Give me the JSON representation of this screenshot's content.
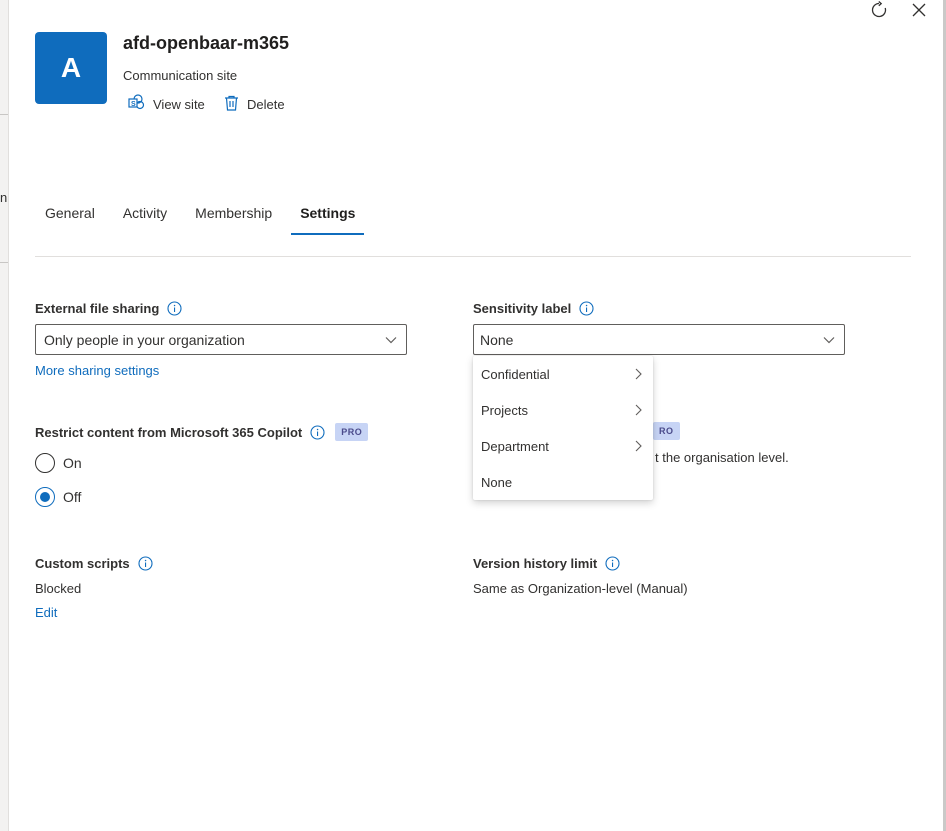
{
  "site": {
    "avatar_letter": "A",
    "title": "afd-openbaar-m365",
    "type": "Communication site"
  },
  "commands": {
    "view_site": "View site",
    "delete": "Delete"
  },
  "tabs": [
    {
      "label": "General"
    },
    {
      "label": "Activity"
    },
    {
      "label": "Membership"
    },
    {
      "label": "Settings",
      "active": true
    }
  ],
  "external_sharing": {
    "label": "External file sharing",
    "value": "Only people in your organization",
    "link": "More sharing settings"
  },
  "sensitivity": {
    "label": "Sensitivity label",
    "value": "None",
    "menu": [
      {
        "label": "Confidential",
        "has_submenu": true
      },
      {
        "label": "Projects",
        "has_submenu": true
      },
      {
        "label": "Department",
        "has_submenu": true
      },
      {
        "label": "None",
        "has_submenu": false
      }
    ]
  },
  "copilot": {
    "label": "Restrict content from Microsoft 365 Copilot",
    "badge": "PRO",
    "options": [
      {
        "label": "On",
        "checked": false
      },
      {
        "label": "Off",
        "checked": true
      }
    ]
  },
  "obscured": {
    "badge": "RO",
    "text": "t the organisation level."
  },
  "custom_scripts": {
    "label": "Custom scripts",
    "value": "Blocked",
    "link": "Edit"
  },
  "version_history": {
    "label": "Version history limit",
    "value": "Same as Organization-level (Manual)"
  },
  "backdrop": {
    "glyph": "n"
  },
  "colors": {
    "accent": "#0f6cbd",
    "badge_bg": "#c7d4f5"
  }
}
